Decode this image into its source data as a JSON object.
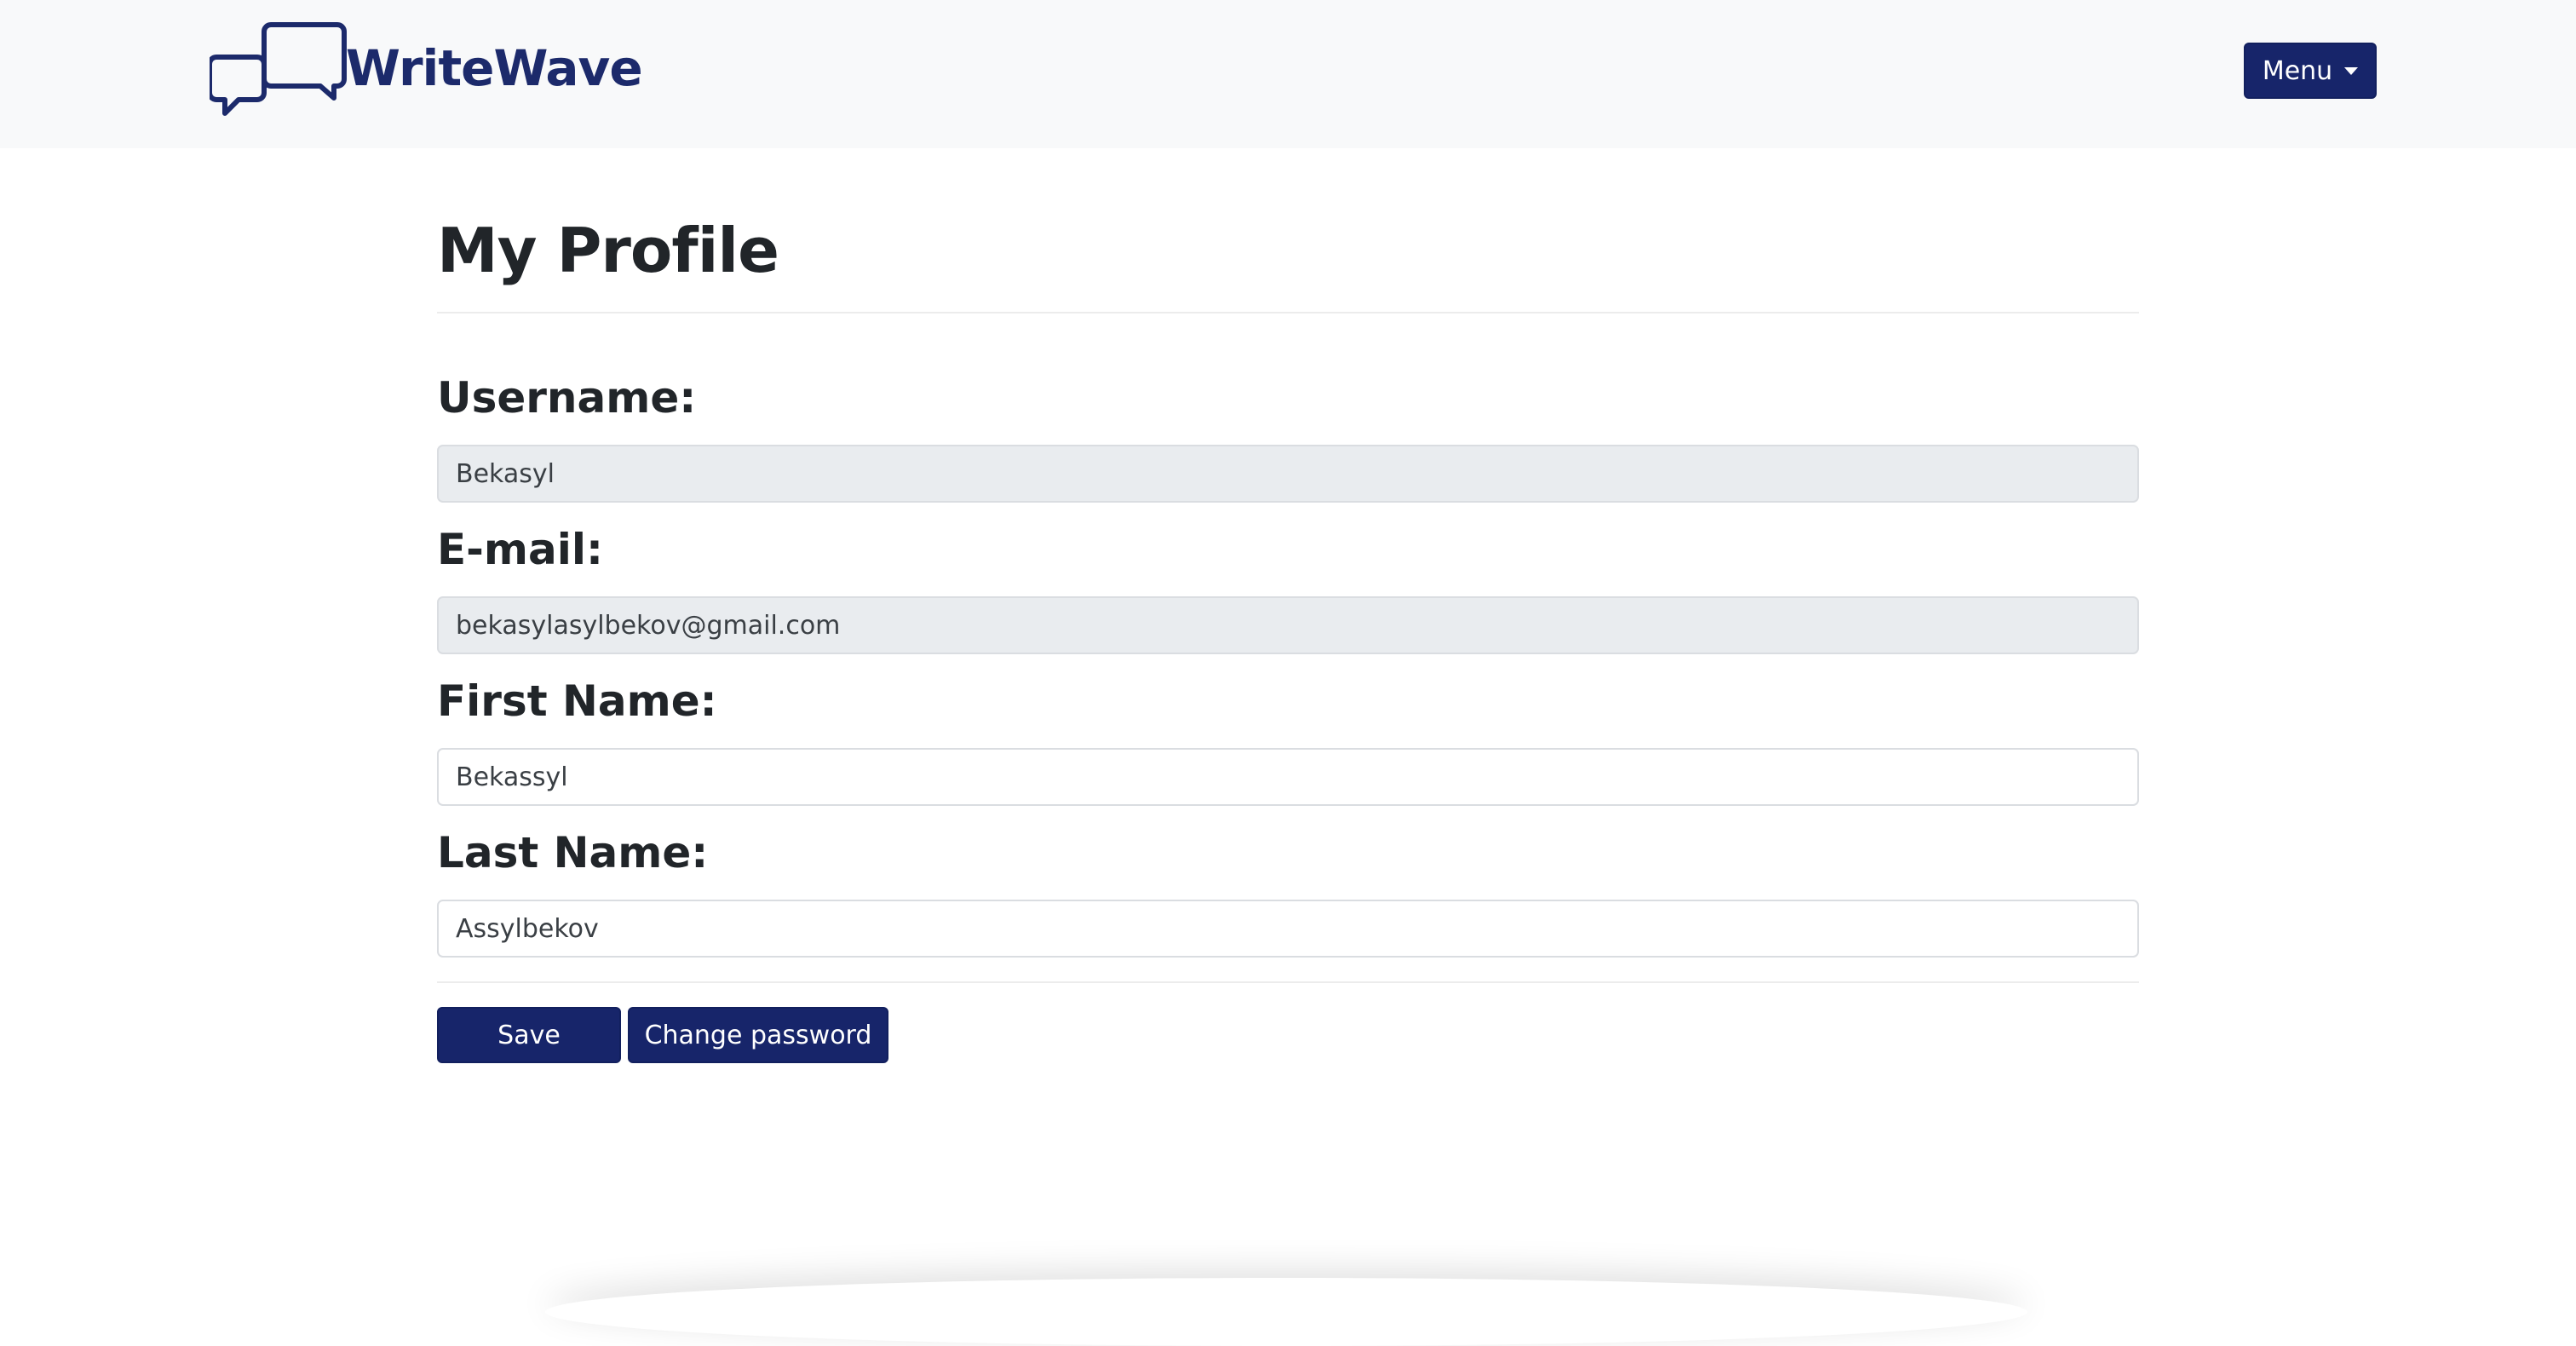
{
  "navbar": {
    "brand_name": "WriteWave",
    "brand_icon": "chat-bubbles-icon",
    "menu_label": "Menu",
    "menu_icon": "caret-down-icon"
  },
  "page": {
    "title": "My Profile"
  },
  "form": {
    "username": {
      "label": "Username:",
      "value": "Bekasyl",
      "readonly": true
    },
    "email": {
      "label": "E-mail:",
      "value": "bekasylasylbekov@gmail.com",
      "readonly": true
    },
    "first_name": {
      "label": "First Name:",
      "value": "Bekassyl",
      "readonly": false
    },
    "last_name": {
      "label": "Last Name:",
      "value": "Assylbekov",
      "readonly": false
    }
  },
  "actions": {
    "save_label": "Save",
    "change_password_label": "Change password"
  },
  "colors": {
    "brand": "#1c2a6b",
    "button_bg": "#17256a",
    "navbar_bg": "#f8f9fa",
    "readonly_input_bg": "#e9ecef"
  }
}
